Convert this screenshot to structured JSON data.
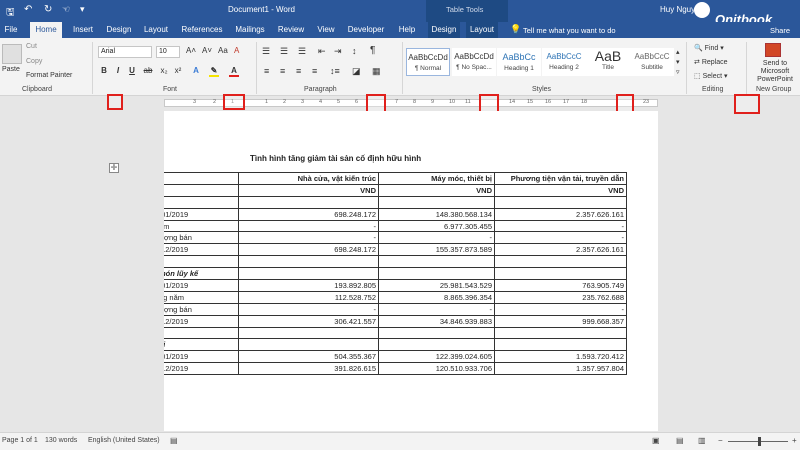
{
  "titlebar": {
    "doc_title": "Document1 - Word",
    "table_tools": "Table Tools",
    "user": "Huy Nguyen",
    "brand": "Onitbook"
  },
  "tabs": [
    {
      "label": "File"
    },
    {
      "label": "Home"
    },
    {
      "label": "Insert"
    },
    {
      "label": "Design"
    },
    {
      "label": "Layout"
    },
    {
      "label": "References"
    },
    {
      "label": "Mailings"
    },
    {
      "label": "Review"
    },
    {
      "label": "View"
    },
    {
      "label": "Developer"
    },
    {
      "label": "Help"
    },
    {
      "label": "Design"
    },
    {
      "label": "Layout"
    }
  ],
  "tell_me": "Tell me what you want to do",
  "share": "Share",
  "clipboard": {
    "paste": "Paste",
    "cut": "Cut",
    "copy": "Copy",
    "format_painter": "Format Painter",
    "group": "Clipboard"
  },
  "font": {
    "name": "Arial",
    "size": "10",
    "group": "Font"
  },
  "paragraph": {
    "group": "Paragraph"
  },
  "styles": {
    "group": "Styles",
    "items": [
      {
        "preview": "AaBbCcDd",
        "name": "¶ Normal"
      },
      {
        "preview": "AaBbCcDd",
        "name": "¶ No Spac..."
      },
      {
        "preview": "AaBbCc",
        "name": "Heading 1"
      },
      {
        "preview": "AaBbCcC",
        "name": "Heading 2"
      },
      {
        "preview": "AaB",
        "name": "Title"
      },
      {
        "preview": "AaBbCcC",
        "name": "Subtitle"
      }
    ]
  },
  "editing": {
    "find": "Find",
    "replace": "Replace",
    "select": "Select",
    "group": "Editing"
  },
  "newgroup": {
    "send": "Send to Microsoft PowerPoint",
    "group": "New Group"
  },
  "ruler": {
    "marks": [
      "3",
      "2",
      "1",
      "1",
      "2",
      "3",
      "4",
      "5",
      "6",
      "7",
      "8",
      "9",
      "10",
      "11",
      "12",
      "13",
      "14",
      "15",
      "16",
      "17",
      "18",
      "19",
      "20",
      "21",
      "22",
      "23"
    ]
  },
  "document": {
    "heading": "Tình hình tăng giảm tài sản cố định hữu hình",
    "columns": [
      "Nhà cửa, vật kiến trúc",
      "Máy móc, thiết bị",
      "Phương tiện vận tải, truyền dẫn"
    ],
    "units": [
      "VND",
      "VND",
      "VND"
    ],
    "rows": [
      {
        "label": "",
        "values": [
          "",
          "",
          ""
        ]
      },
      {
        "label": "/01/2019",
        "values": [
          "698.248.172",
          "148.380.568.134",
          "2.357.626.161"
        ]
      },
      {
        "label": "ăm",
        "values": [
          "-",
          "6.977.305.455",
          "-"
        ]
      },
      {
        "label": "ượng bán",
        "values": [
          "-",
          "-",
          "-"
        ]
      },
      {
        "label": "/12/2019",
        "values": [
          "698.248.172",
          "155.357.873.589",
          "2.357.626.161"
        ]
      },
      {
        "label": "",
        "values": [
          "",
          "",
          ""
        ]
      },
      {
        "label": "món lũy kế",
        "values": [
          "",
          "",
          ""
        ],
        "bold": true
      },
      {
        "label": "/01/2019",
        "values": [
          "193.892.805",
          "25.981.543.529",
          "763.905.749"
        ]
      },
      {
        "label": "ng năm",
        "values": [
          "112.528.752",
          "8.865.396.354",
          "235.762.688"
        ]
      },
      {
        "label": "ượng bán",
        "values": [
          "-",
          "-",
          "-"
        ]
      },
      {
        "label": "/12/2019",
        "values": [
          "306.421.557",
          "34.846.939.883",
          "999.668.357"
        ]
      },
      {
        "label": "",
        "values": [
          "",
          "",
          ""
        ]
      },
      {
        "label": "ại",
        "values": [
          "",
          "",
          ""
        ],
        "bold": true
      },
      {
        "label": "/01/2019",
        "values": [
          "504.355.367",
          "122.399.024.605",
          "1.593.720.412"
        ]
      },
      {
        "label": "/12/2019",
        "values": [
          "391.826.615",
          "120.510.933.706",
          "1.357.957.804"
        ]
      }
    ]
  },
  "status": {
    "page": "Page 1 of 1",
    "words": "130 words",
    "language": "English (United States)"
  },
  "colors": {
    "accent": "#2b579a",
    "highlight": "#e0201c"
  }
}
